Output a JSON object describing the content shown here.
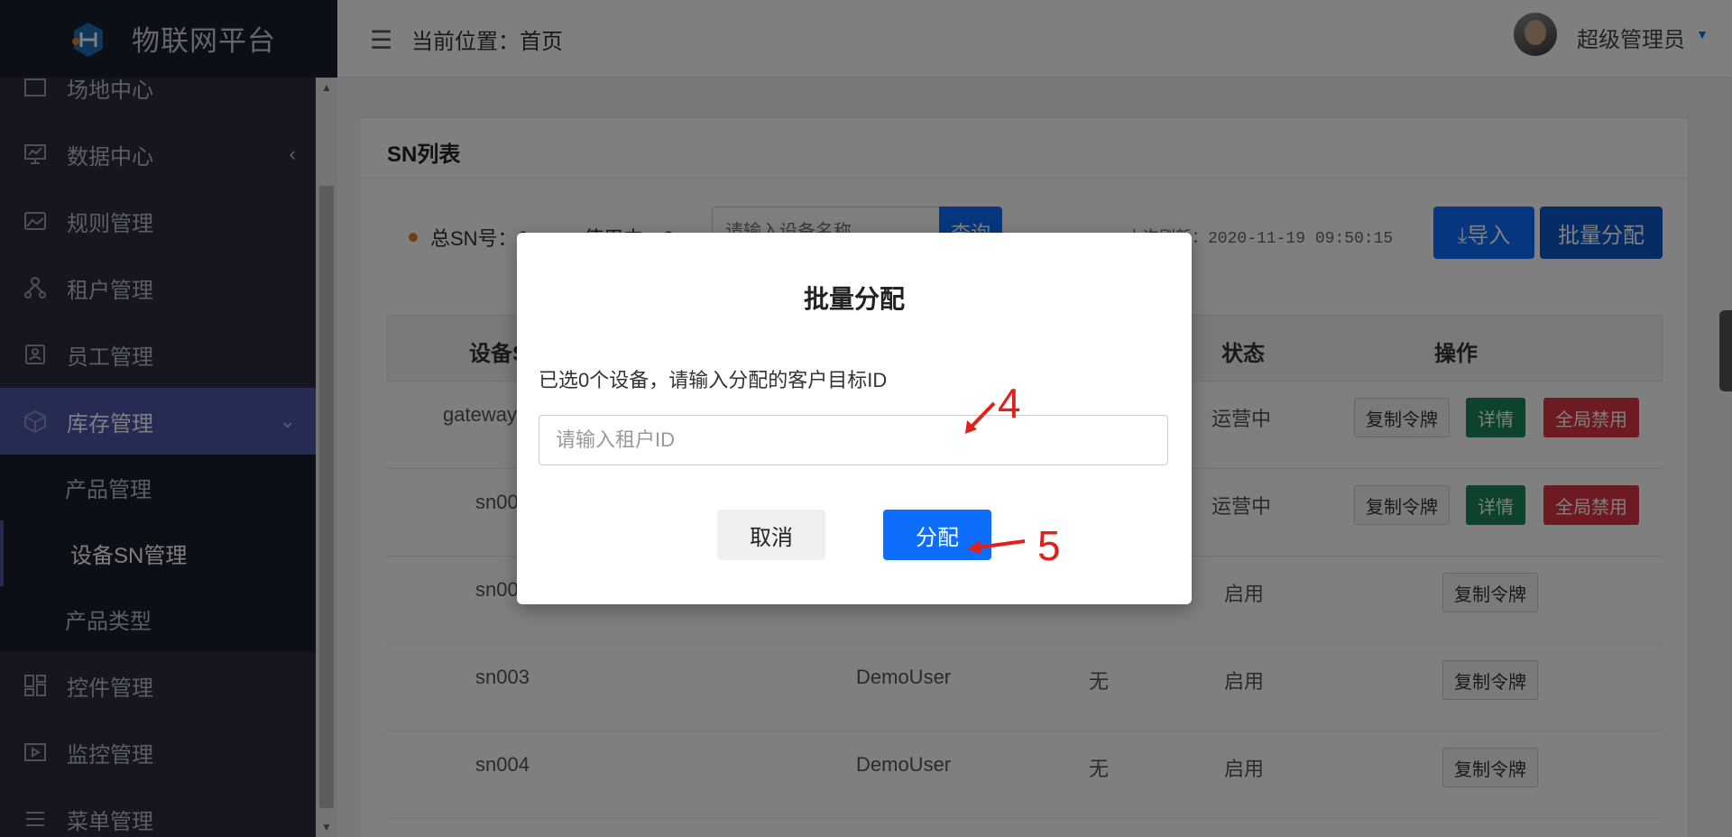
{
  "brand": {
    "title": "物联网平台",
    "logo_icon": "iot-logo-icon"
  },
  "sidebar": {
    "items": [
      {
        "label": "场地中心",
        "icon": "venue-icon"
      },
      {
        "label": "数据中心",
        "icon": "monitor-chart-icon",
        "arrow": "‹"
      },
      {
        "label": "规则管理",
        "icon": "image-rules-icon"
      },
      {
        "label": "租户管理",
        "icon": "tenant-tree-icon"
      },
      {
        "label": "员工管理",
        "icon": "staff-badge-icon"
      },
      {
        "label": "库存管理",
        "icon": "cube-icon",
        "arrow": "⌄"
      }
    ],
    "submenu": [
      {
        "label": "产品管理"
      },
      {
        "label": "设备SN管理"
      },
      {
        "label": "产品类型"
      }
    ],
    "items_after": [
      {
        "label": "控件管理",
        "icon": "grid-widgets-icon"
      },
      {
        "label": "监控管理",
        "icon": "play-box-icon"
      },
      {
        "label": "菜单管理",
        "icon": "list-menu-icon"
      }
    ]
  },
  "header": {
    "breadcrumb": "当前位置：首页",
    "user_name": "超级管理员",
    "caret": "▼",
    "hamburger": "☰"
  },
  "card": {
    "title": "SN列表",
    "stats": [
      {
        "label": "总SN号：6",
        "color": "#e67e22"
      },
      {
        "label": "使用中：2",
        "color": "#17a2b8"
      }
    ],
    "search_placeholder": "请输入设备名称",
    "search_button": "查询",
    "refresh_text": "上次刷新：2020-11-19 09:50:15",
    "import_button": "导入",
    "batch_button": "批量分配"
  },
  "table": {
    "headers": [
      "设备SN",
      "状态",
      "操作"
    ],
    "rows": [
      {
        "sn": "gateway",
        "user": "",
        "extra": "",
        "status": "运营中",
        "ops": [
          "复制令牌",
          "详情",
          "全局禁用"
        ]
      },
      {
        "sn": "sn001",
        "user": "",
        "extra": "",
        "status": "运营中",
        "ops": [
          "复制令牌",
          "详情",
          "全局禁用"
        ]
      },
      {
        "sn": "sn002",
        "user": "",
        "extra": "",
        "status": "启用",
        "ops": [
          "复制令牌"
        ]
      },
      {
        "sn": "sn003",
        "user": "DemoUser",
        "extra": "无",
        "status": "启用",
        "ops": [
          "复制令牌"
        ]
      },
      {
        "sn": "sn004",
        "user": "DemoUser",
        "extra": "无",
        "status": "启用",
        "ops": [
          "复制令牌"
        ]
      }
    ]
  },
  "modal": {
    "title": "批量分配",
    "description": "已选0个设备，请输入分配的客户目标ID",
    "input_placeholder": "请输入租户ID",
    "cancel_label": "取消",
    "assign_label": "分配"
  },
  "annotations": {
    "step4": "4",
    "step5": "5",
    "color": "#e0201b"
  }
}
